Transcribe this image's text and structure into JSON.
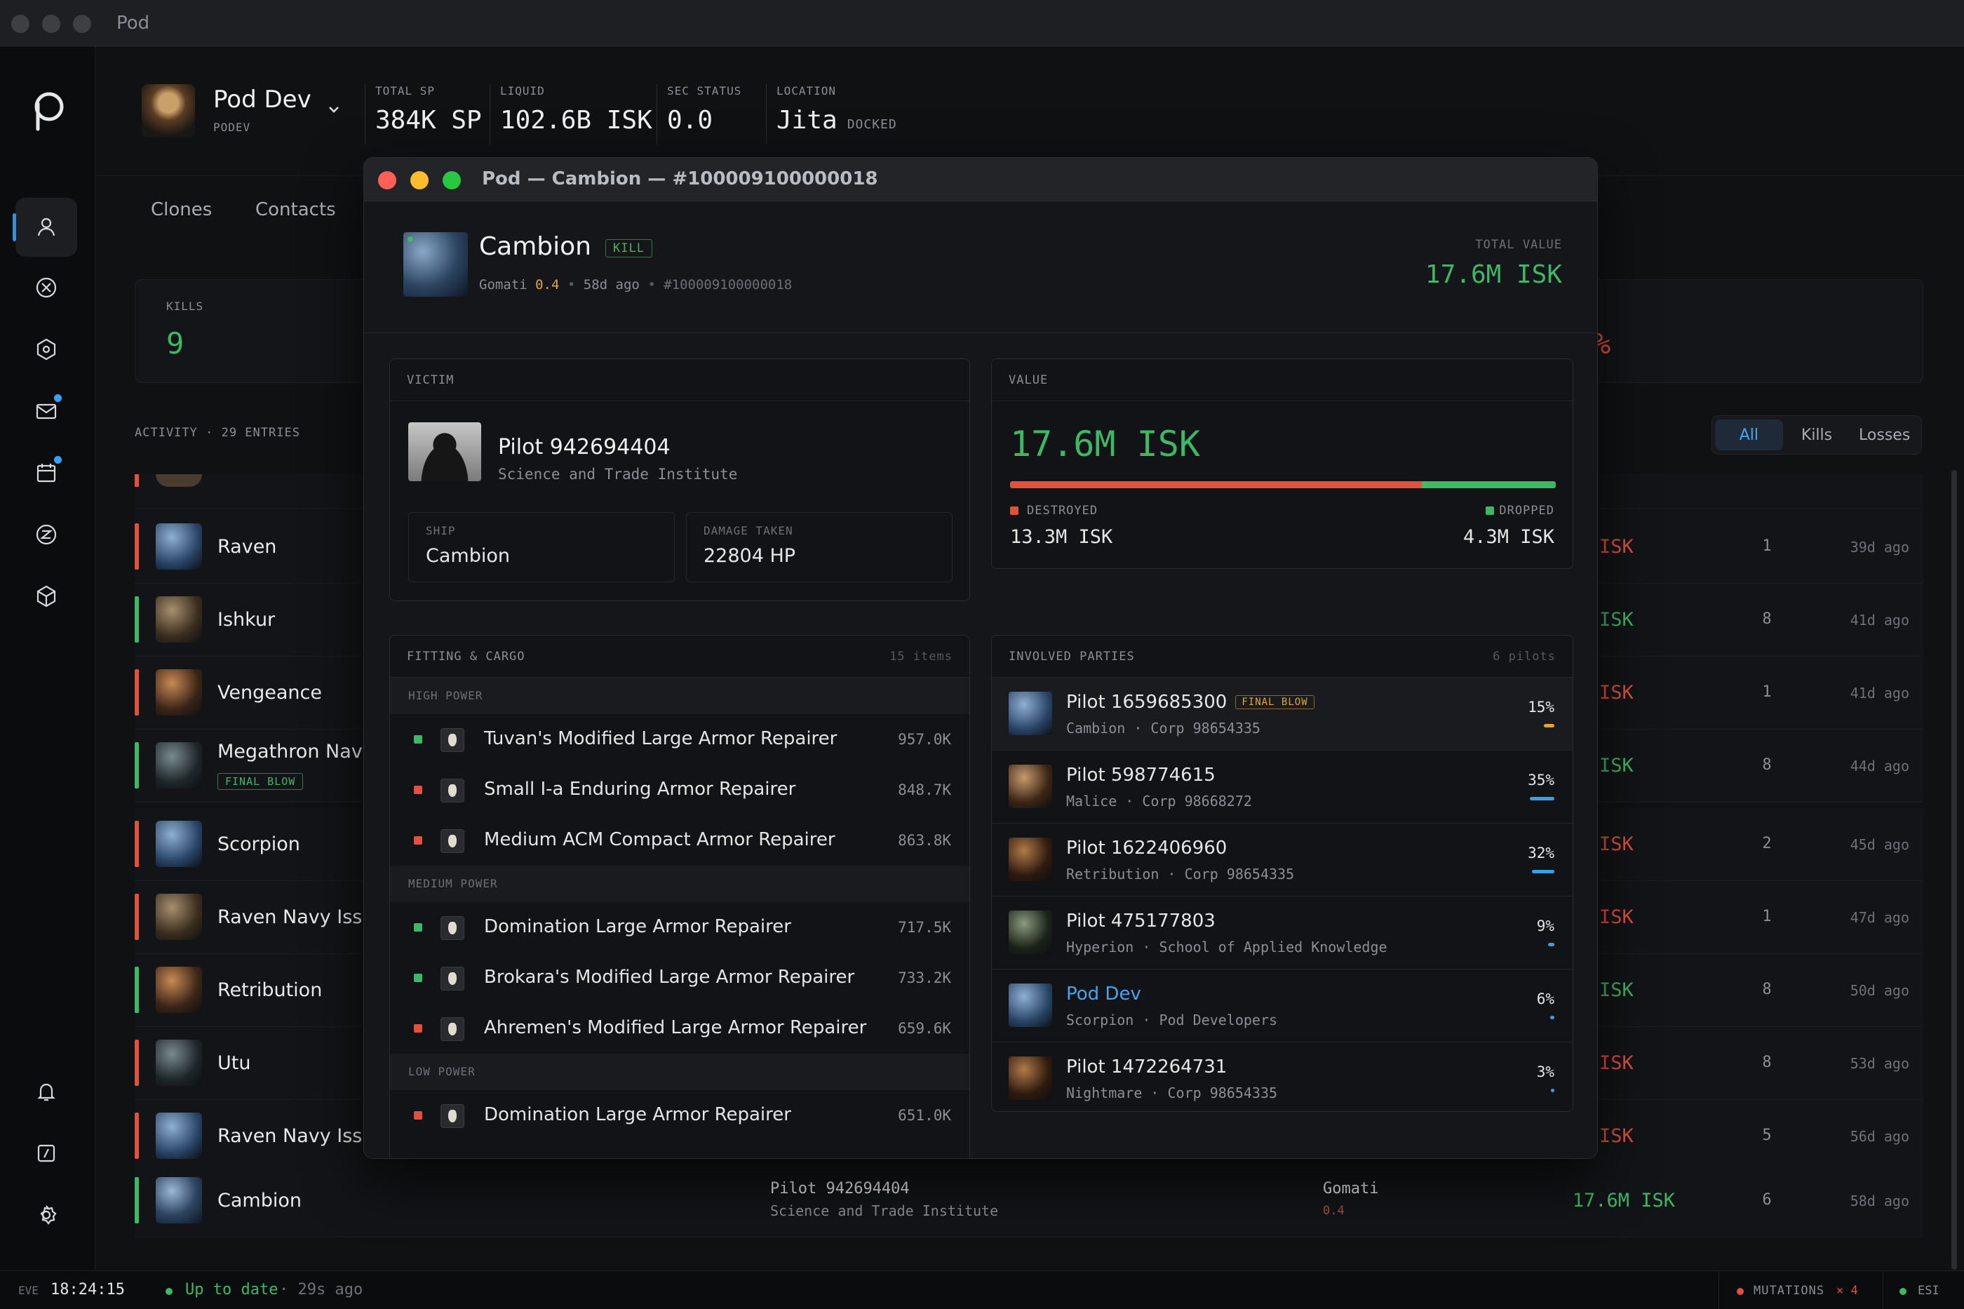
{
  "window": {
    "title": "Pod"
  },
  "rail": {
    "items": [
      "profile",
      "combat",
      "fitting",
      "mail",
      "calendar",
      "market",
      "inventory"
    ],
    "bottom": [
      "notifications",
      "terminal",
      "settings"
    ]
  },
  "header": {
    "pilot_name": "Pod Dev",
    "pilot_ticker": "PODEV",
    "stats": [
      {
        "label": "TOTAL SP",
        "value": "384K SP"
      },
      {
        "label": "LIQUID",
        "value": "102.6B ISK"
      },
      {
        "label": "SEC STATUS",
        "value": "0.0"
      },
      {
        "label": "LOCATION",
        "value": "Jita",
        "sub": "DOCKED"
      }
    ]
  },
  "tabs": [
    "Clones",
    "Contacts"
  ],
  "kills": {
    "label": "KILLS",
    "value": "9",
    "right_fragment": "%"
  },
  "activity": {
    "label": "ACTIVITY · 29 ENTRIES",
    "filters": [
      "All",
      "Kills",
      "Losses"
    ],
    "active_filter": "All"
  },
  "rows": [
    {
      "name": "Raven",
      "type": "loss",
      "isk": "ISK",
      "count": "1",
      "ago": "39d ago"
    },
    {
      "name": "Ishkur",
      "type": "kill",
      "isk": "ISK",
      "count": "8",
      "ago": "41d ago"
    },
    {
      "name": "Vengeance",
      "type": "loss",
      "isk": "ISK",
      "count": "1",
      "ago": "41d ago"
    },
    {
      "name": "Megathron Navy",
      "type": "kill",
      "badge": "FINAL BLOW",
      "isk": "ISK",
      "count": "8",
      "ago": "44d ago"
    },
    {
      "name": "Scorpion",
      "type": "loss",
      "isk": "ISK",
      "count": "2",
      "ago": "45d ago"
    },
    {
      "name": "Raven Navy Issue",
      "type": "loss",
      "isk": "ISK",
      "count": "1",
      "ago": "47d ago"
    },
    {
      "name": "Retribution",
      "type": "kill",
      "isk": "ISK",
      "count": "8",
      "ago": "50d ago"
    },
    {
      "name": "Utu",
      "type": "loss",
      "isk": "ISK",
      "count": "8",
      "ago": "53d ago"
    },
    {
      "name": "Raven Navy Issue",
      "type": "loss",
      "isk": "ISK",
      "count": "5",
      "ago": "56d ago"
    }
  ],
  "last_row": {
    "name": "Cambion",
    "victim": "Pilot 942694404",
    "victim_corp": "Science and Trade Institute",
    "system": "Gomati",
    "sec": "0.4",
    "value": "17.6M ISK",
    "count": "6",
    "ago": "58d ago"
  },
  "status": {
    "eve_label": "EVE",
    "time": "18:24:15",
    "sync": "Up to date",
    "sync_ago": "· 29s ago",
    "mutations": "MUTATIONS",
    "mutations_count": "× 4",
    "esi": "ESI"
  },
  "modal": {
    "title": "Pod — Cambion — #100009100000018",
    "ship": "Cambion",
    "badge": "KILL",
    "system": "Gomati",
    "sec": "0.4",
    "ago": "58d ago",
    "id": "#100009100000018",
    "total_label": "TOTAL VALUE",
    "total": "17.6M ISK",
    "victim": {
      "header": "VICTIM",
      "name": "Pilot 942694404",
      "corp": "Science and Trade Institute",
      "ship_label": "SHIP",
      "ship": "Cambion",
      "dmg_label": "DAMAGE TAKEN",
      "dmg": "22804 HP"
    },
    "value": {
      "header": "VALUE",
      "total": "17.6M ISK",
      "destroyed_label": "DESTROYED",
      "destroyed": "13.3M ISK",
      "dropped_label": "DROPPED",
      "dropped": "4.3M ISK",
      "destroyed_fraction": 0.755
    },
    "fitting": {
      "header": "FITTING & CARGO",
      "count": "15 items",
      "sections": [
        {
          "name": "HIGH POWER",
          "items": [
            {
              "name": "Tuvan's Modified Large Armor Repairer",
              "price": "957.0K",
              "status": "dropped"
            },
            {
              "name": "Small I-a Enduring Armor Repairer",
              "price": "848.7K",
              "status": "destroyed"
            },
            {
              "name": "Medium ACM Compact Armor Repairer",
              "price": "863.8K",
              "status": "destroyed"
            }
          ]
        },
        {
          "name": "MEDIUM POWER",
          "items": [
            {
              "name": "Domination Large Armor Repairer",
              "price": "717.5K",
              "status": "dropped"
            },
            {
              "name": "Brokara's Modified Large Armor Repairer",
              "price": "733.2K",
              "status": "dropped"
            },
            {
              "name": "Ahremen's Modified Large Armor Repairer",
              "price": "659.6K",
              "status": "destroyed"
            }
          ]
        },
        {
          "name": "LOW POWER",
          "items": [
            {
              "name": "Domination Large Armor Repairer",
              "price": "651.0K",
              "status": "destroyed"
            }
          ]
        }
      ]
    },
    "involved": {
      "header": "INVOLVED PARTIES",
      "count": "6 pilots",
      "parties": [
        {
          "name": "Pilot 1659685300",
          "badge": "FINAL BLOW",
          "ship": "Cambion",
          "corp": "Corp 98654335",
          "pct": "15%",
          "frac": 0.15,
          "color": "#e0a63a"
        },
        {
          "name": "Pilot 598774615",
          "ship": "Malice",
          "corp": "Corp 98668272",
          "pct": "35%",
          "frac": 0.35,
          "color": "#3aa0e6"
        },
        {
          "name": "Pilot 1622406960",
          "ship": "Retribution",
          "corp": "Corp 98654335",
          "pct": "32%",
          "frac": 0.32,
          "color": "#3aa0e6"
        },
        {
          "name": "Pilot 475177803",
          "ship": "Hyperion",
          "corp": "School of Applied Knowledge",
          "pct": "9%",
          "frac": 0.09,
          "color": "#3aa0e6"
        },
        {
          "name": "Pod Dev",
          "ship": "Scorpion",
          "corp": "Pod Developers",
          "pct": "6%",
          "frac": 0.06,
          "color": "#3aa0e6",
          "self": true
        },
        {
          "name": "Pilot 1472264731",
          "ship": "Nightmare",
          "corp": "Corp 98654335",
          "pct": "3%",
          "frac": 0.03,
          "color": "#3aa0e6"
        }
      ]
    }
  },
  "colors": {
    "kill": "#3fb865",
    "loss": "#e0513e",
    "accent": "#3a8fd6",
    "gold": "#e0a63a"
  }
}
